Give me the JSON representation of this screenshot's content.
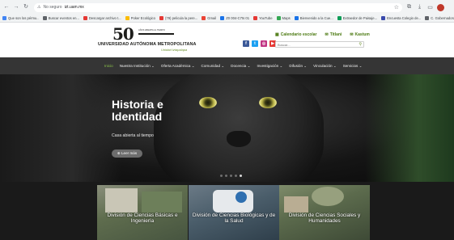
{
  "browser": {
    "security_label": "No seguro",
    "url": "izt.uam.mx",
    "bookmarks": [
      {
        "label": "Que son los pérmu..",
        "color": "#4285f4"
      },
      {
        "label": "Buscar eventos en...",
        "color": "#5f6368"
      },
      {
        "label": "Descargar archivo t...",
        "color": "#e53935"
      },
      {
        "label": "Poker Ecológico",
        "color": "#fbbc04"
      },
      {
        "label": "(79) pelicula la pere...",
        "color": "#e53935"
      },
      {
        "label": "Gmail",
        "color": "#ea4335"
      },
      {
        "label": "Z0 004-C7ts 01",
        "color": "#1a73e8"
      },
      {
        "label": "YouTube",
        "color": "#e53935"
      },
      {
        "label": "Maps",
        "color": "#34a853"
      },
      {
        "label": "Bienvenido a la Cue...",
        "color": "#1a73e8"
      },
      {
        "label": "Extraedor de Paisaje...",
        "color": "#0f9d58"
      },
      {
        "label": "Encuesta Colegio de...",
        "color": "#3949ab"
      },
      {
        "label": "C. Gobernadora Ia...",
        "color": "#5f6368"
      }
    ],
    "all_bookmarks_label": "Todos los favo"
  },
  "header": {
    "logo_number": "50",
    "logo_tagline": "AÑOS ABIERTA AL TIEMPO",
    "university_name": "UNIVERSIDAD AUTÓNOMA METROPOLITANA",
    "unit_name": "Unidad Iztapalapa",
    "quick_links": [
      {
        "label": "Calendario escolar",
        "icon": "calendar-icon"
      },
      {
        "label": "Titlani",
        "icon": "mail-icon"
      },
      {
        "label": "Kastum",
        "icon": "mail-icon"
      }
    ],
    "social": [
      {
        "name": "facebook",
        "letter": "f",
        "color": "#3b5998"
      },
      {
        "name": "twitter",
        "letter": "t",
        "color": "#1da1f2"
      },
      {
        "name": "instagram",
        "letter": "◎",
        "color": "#c13584"
      },
      {
        "name": "youtube",
        "letter": "▶",
        "color": "#e53935"
      }
    ],
    "search_placeholder": "Buscar..."
  },
  "nav": {
    "items": [
      "Inicio",
      "Nuestra Institución ⌄",
      "Oferta Académica ⌄",
      "Comunidad ⌄",
      "Docencia ⌄",
      "Investigación ⌄",
      "Difusión ⌄",
      "Vinculación ⌄",
      "Servicios ⌄"
    ],
    "active_index": 0
  },
  "hero": {
    "title_line1": "Historia e",
    "title_line2": "Identidad",
    "subtitle": "Casa abierta al tiempo",
    "button_label": "⊕ Leer más",
    "slides": 5,
    "active_slide": 4
  },
  "divisions": [
    {
      "label": "División de Ciencias Básicas e Ingeniería"
    },
    {
      "label": "División de Ciencias Biológicas y de la Salud"
    },
    {
      "label": "División de Ciencias Sociales y Humanidades"
    }
  ],
  "colors": {
    "nav_bg": "#353535",
    "accent_green": "#8bc34a",
    "quick_link_green": "#4c7a12"
  }
}
